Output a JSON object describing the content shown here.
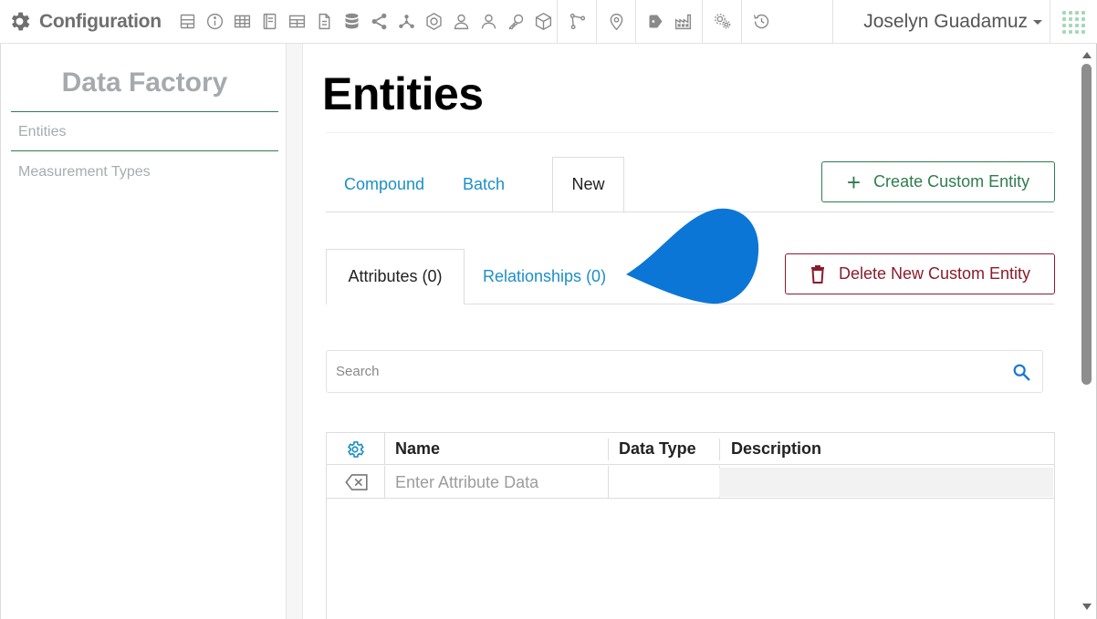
{
  "app": {
    "title": "Configuration"
  },
  "toolbar": {
    "icons": [
      "form-icon",
      "info-icon",
      "table-icon",
      "book-icon",
      "table-alt-icon",
      "document-icon",
      "database-icon",
      "share-icon",
      "network-icon",
      "cd-icon",
      "user-outline-icon",
      "user-icon",
      "key-icon",
      "cube-icon",
      "connector-icon",
      "location-pin-icon",
      "tag-icon",
      "factory-icon",
      "settings-gears-icon",
      "history-icon"
    ]
  },
  "user": {
    "name": "Joselyn Guadamuz"
  },
  "sidebar": {
    "title": "Data Factory",
    "items": [
      {
        "label": "Entities"
      },
      {
        "label": "Measurement Types"
      }
    ]
  },
  "main": {
    "title": "Entities",
    "tabs": [
      {
        "label": "Compound"
      },
      {
        "label": "Batch"
      },
      {
        "label": "New"
      }
    ],
    "create_button": "Create Custom Entity",
    "subtabs": [
      {
        "label": "Attributes (0)"
      },
      {
        "label": "Relationships (0)"
      }
    ],
    "delete_button": "Delete New Custom Entity",
    "search": {
      "placeholder": "Search",
      "value": ""
    },
    "grid": {
      "columns": [
        "Name",
        "Data Type",
        "Description"
      ],
      "new_row_placeholder": "Enter Attribute Data"
    }
  },
  "colors": {
    "accent_blue": "#1c8fc7",
    "green": "#2e7d4f",
    "danger": "#8b1c2c",
    "blob": "#0b76d6"
  }
}
